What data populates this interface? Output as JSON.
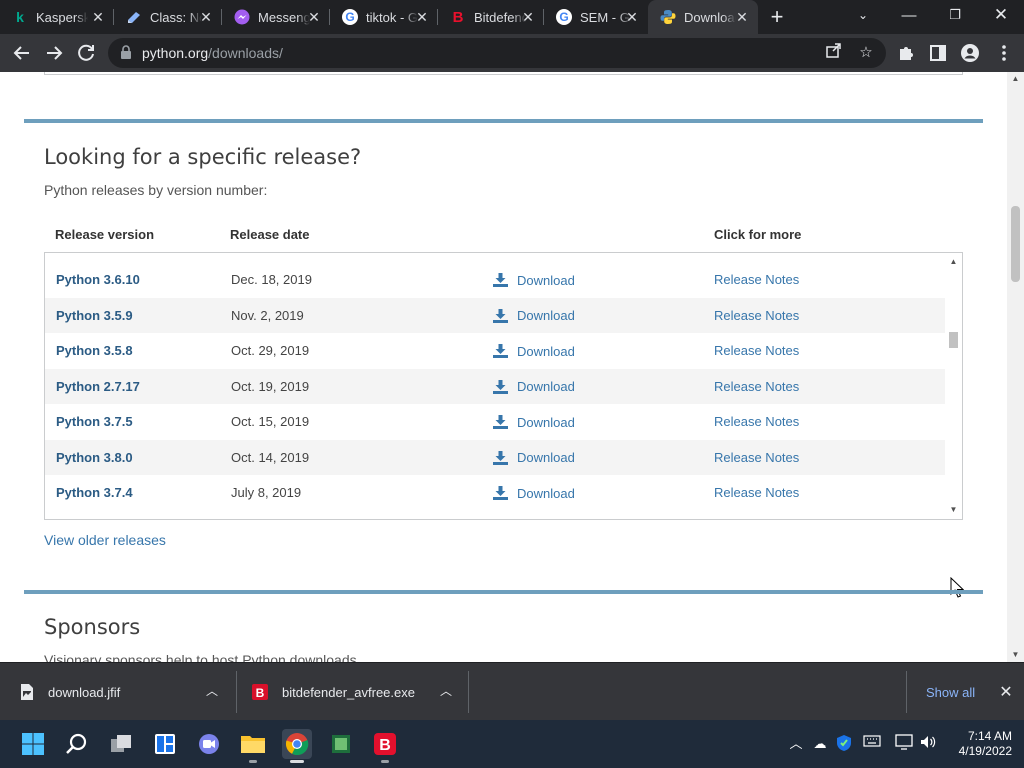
{
  "browser": {
    "tabs": [
      {
        "title": "Kaspersky",
        "icon": "kaspersky-icon",
        "active": false
      },
      {
        "title": "Class: Notes",
        "icon": "classnotes-icon",
        "active": false
      },
      {
        "title": "Messenger",
        "icon": "messenger-icon",
        "active": false
      },
      {
        "title": "tiktok - Google",
        "icon": "google-icon",
        "active": false
      },
      {
        "title": "Bitdefender",
        "icon": "bitdefender-icon",
        "active": false
      },
      {
        "title": "SEM - Google",
        "icon": "google-icon",
        "active": false
      },
      {
        "title": "Download",
        "icon": "python-icon",
        "active": true
      }
    ],
    "url_domain": "python.org",
    "url_path": "/downloads/"
  },
  "page": {
    "section_title": "Looking for a specific release?",
    "section_subtitle": "Python releases by version number:",
    "columns": {
      "version": "Release version",
      "date": "Release date",
      "more": "Click for more"
    },
    "releases": [
      {
        "version": "Python 3.6.10",
        "date": "Dec. 18, 2019",
        "download": "Download",
        "notes": "Release Notes"
      },
      {
        "version": "Python 3.5.9",
        "date": "Nov. 2, 2019",
        "download": "Download",
        "notes": "Release Notes"
      },
      {
        "version": "Python 3.5.8",
        "date": "Oct. 29, 2019",
        "download": "Download",
        "notes": "Release Notes"
      },
      {
        "version": "Python 2.7.17",
        "date": "Oct. 19, 2019",
        "download": "Download",
        "notes": "Release Notes"
      },
      {
        "version": "Python 3.7.5",
        "date": "Oct. 15, 2019",
        "download": "Download",
        "notes": "Release Notes"
      },
      {
        "version": "Python 3.8.0",
        "date": "Oct. 14, 2019",
        "download": "Download",
        "notes": "Release Notes"
      },
      {
        "version": "Python 3.7.4",
        "date": "July 8, 2019",
        "download": "Download",
        "notes": "Release Notes"
      }
    ],
    "older_link": "View older releases",
    "sponsors_title": "Sponsors",
    "sponsors_subtitle": "Visionary sponsors help to host Python downloads."
  },
  "downloads_bar": {
    "items": [
      {
        "filename": "download.jfif",
        "icon": "image-file-icon"
      },
      {
        "filename": "bitdefender_avfree.exe",
        "icon": "bitdefender-icon"
      }
    ],
    "show_all": "Show all"
  },
  "taskbar": {
    "time": "7:14 AM",
    "date": "4/19/2022"
  },
  "colors": {
    "tab_strip": "#202124",
    "toolbar": "#35363a",
    "python_blue": "#3776ab",
    "version_link": "#2b5b84",
    "section_rule": "#6e9fbd",
    "taskbar": "#1f2b3a"
  }
}
